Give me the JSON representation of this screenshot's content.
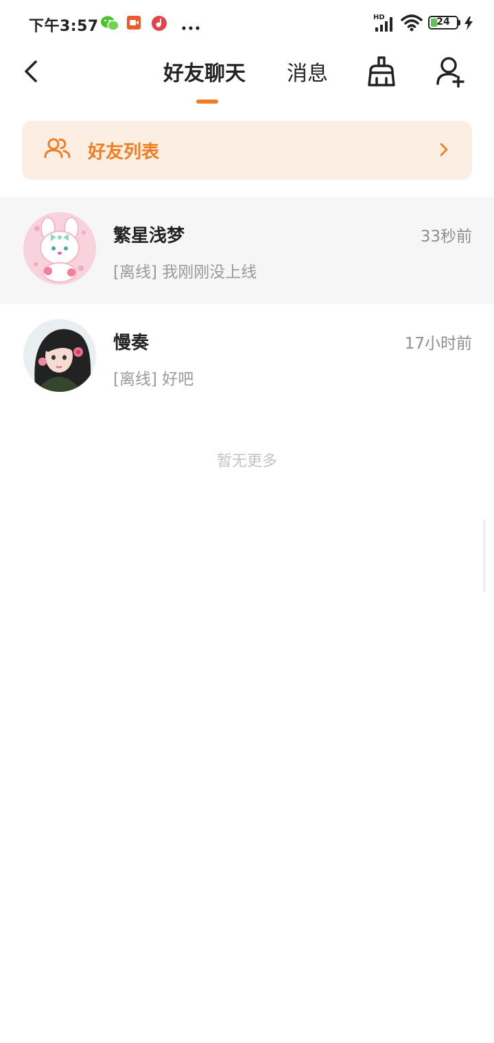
{
  "status_bar": {
    "time": "下午3:57",
    "notification_icons": [
      "wechat-icon",
      "video-app-icon",
      "music-app-icon",
      "more-dots-icon"
    ],
    "signal_label": "HD",
    "battery": "24",
    "charging": true
  },
  "header": {
    "tabs": [
      {
        "label": "好友聊天",
        "active": true
      },
      {
        "label": "消息",
        "active": false
      }
    ],
    "icons": [
      "clean-broom-icon",
      "add-friend-icon"
    ]
  },
  "friend_list": {
    "label": "好友列表"
  },
  "chats": [
    {
      "name": "繁星浅梦",
      "time": "33秒前",
      "preview": "[离线] 我刚刚没上线",
      "avatar": "pink-cartoon-avatar"
    },
    {
      "name": "慢奏",
      "time": "17小时前",
      "preview": "[离线] 好吧",
      "avatar": "girl-illustration-avatar"
    }
  ],
  "empty_hint": "暂无更多",
  "colors": {
    "accent": "#ef7d22",
    "banner_bg": "#fdeee3",
    "row_highlight": "#f6f6f6",
    "battery_green": "#5fc35a"
  }
}
